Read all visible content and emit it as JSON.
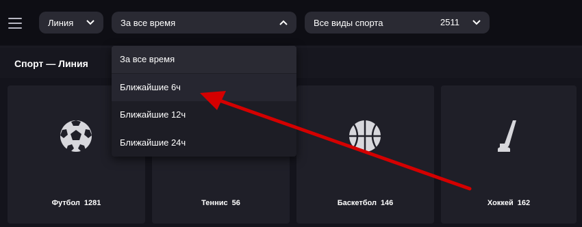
{
  "topbar": {
    "menu_icon": "hamburger-icon",
    "line_select": {
      "label": "Линия",
      "icon": "chevron-down-icon"
    },
    "period_select": {
      "label": "За все время",
      "icon": "chevron-up-icon"
    },
    "sport_select": {
      "label": "Все виды спорта",
      "count": "2511",
      "icon": "chevron-down-icon"
    }
  },
  "section": {
    "title": "Спорт — Линия"
  },
  "period_dropdown": {
    "options": [
      {
        "label": "За все время",
        "state": "selected"
      },
      {
        "label": "Ближайшие 6ч",
        "state": "hovered"
      },
      {
        "label": "Ближайшие 12ч",
        "state": "normal"
      },
      {
        "label": "Ближайшие 24ч",
        "state": "normal"
      }
    ]
  },
  "sports": [
    {
      "name": "Футбол",
      "count": "1281",
      "icon": "soccer-ball-icon"
    },
    {
      "name": "Теннис",
      "count": "56",
      "icon": "tennis-ball-icon"
    },
    {
      "name": "Баскетбол",
      "count": "146",
      "icon": "basketball-icon"
    },
    {
      "name": "Хоккей",
      "count": "162",
      "icon": "hockey-stick-icon"
    }
  ],
  "annotation": {
    "type": "red-arrow",
    "color": "#d40000",
    "points_to": "Ближайшие 6ч"
  },
  "colors": {
    "background": "#0e0e14",
    "pill": "#2a2a33",
    "card": "#1f1f28",
    "dropdown": "#1d1d25",
    "icon": "#d7d7dc"
  }
}
